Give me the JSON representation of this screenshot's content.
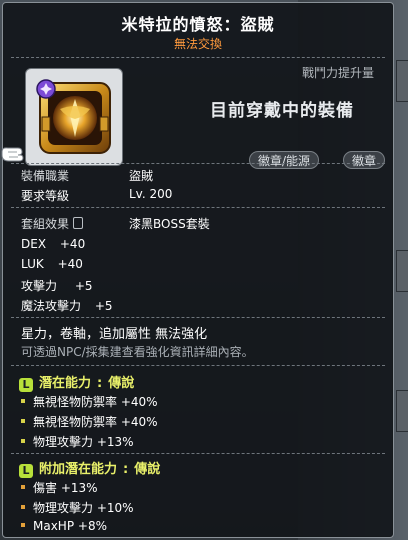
{
  "item": {
    "title": "米特拉的憤怒：盜賊",
    "tradeability": "無法交換",
    "combat_power_label": "戰鬥力提升量",
    "equipped_label": "目前穿戴中的裝備",
    "tags": [
      "徽章/能源",
      "徽章"
    ]
  },
  "requirements": {
    "job_label": "裝備職業",
    "job_value": "盜賊",
    "level_label": "要求等級",
    "level_value": "Lv. 200"
  },
  "set_effect": {
    "label": "套組效果",
    "value": "漆黑BOSS套裝"
  },
  "stats": [
    {
      "name": "DEX",
      "value": "+40"
    },
    {
      "name": "LUK",
      "value": "+40"
    },
    {
      "name": "攻擊力",
      "value": "+5"
    },
    {
      "name": "魔法攻擊力",
      "value": "+5"
    }
  ],
  "notes": {
    "restriction": "星力，卷軸，追加屬性 無法強化",
    "hint": "可透過NPC/採集建查看強化資訊詳細內容。"
  },
  "potential": {
    "badge": "L",
    "label": "潛在能力",
    "grade": "傳說",
    "lines": [
      "無視怪物防禦率 +40%",
      "無視怪物防禦率 +40%",
      "物理攻擊力 +13%"
    ]
  },
  "additional_potential": {
    "badge": "L",
    "label": "附加潛在能力",
    "grade": "傳說",
    "lines": [
      "傷害 +13%",
      "物理攻擊力 +10%",
      "MaxHP +8%"
    ]
  },
  "colors": {
    "potential_accent": "#e9f06a",
    "untradeable": "#ff9a3d",
    "legendary_badge": "#b8e03a"
  },
  "icons": {
    "item": "mitra-rage-emblem-icon",
    "lock": "lock-icon",
    "cursor": "glove-cursor-icon"
  }
}
